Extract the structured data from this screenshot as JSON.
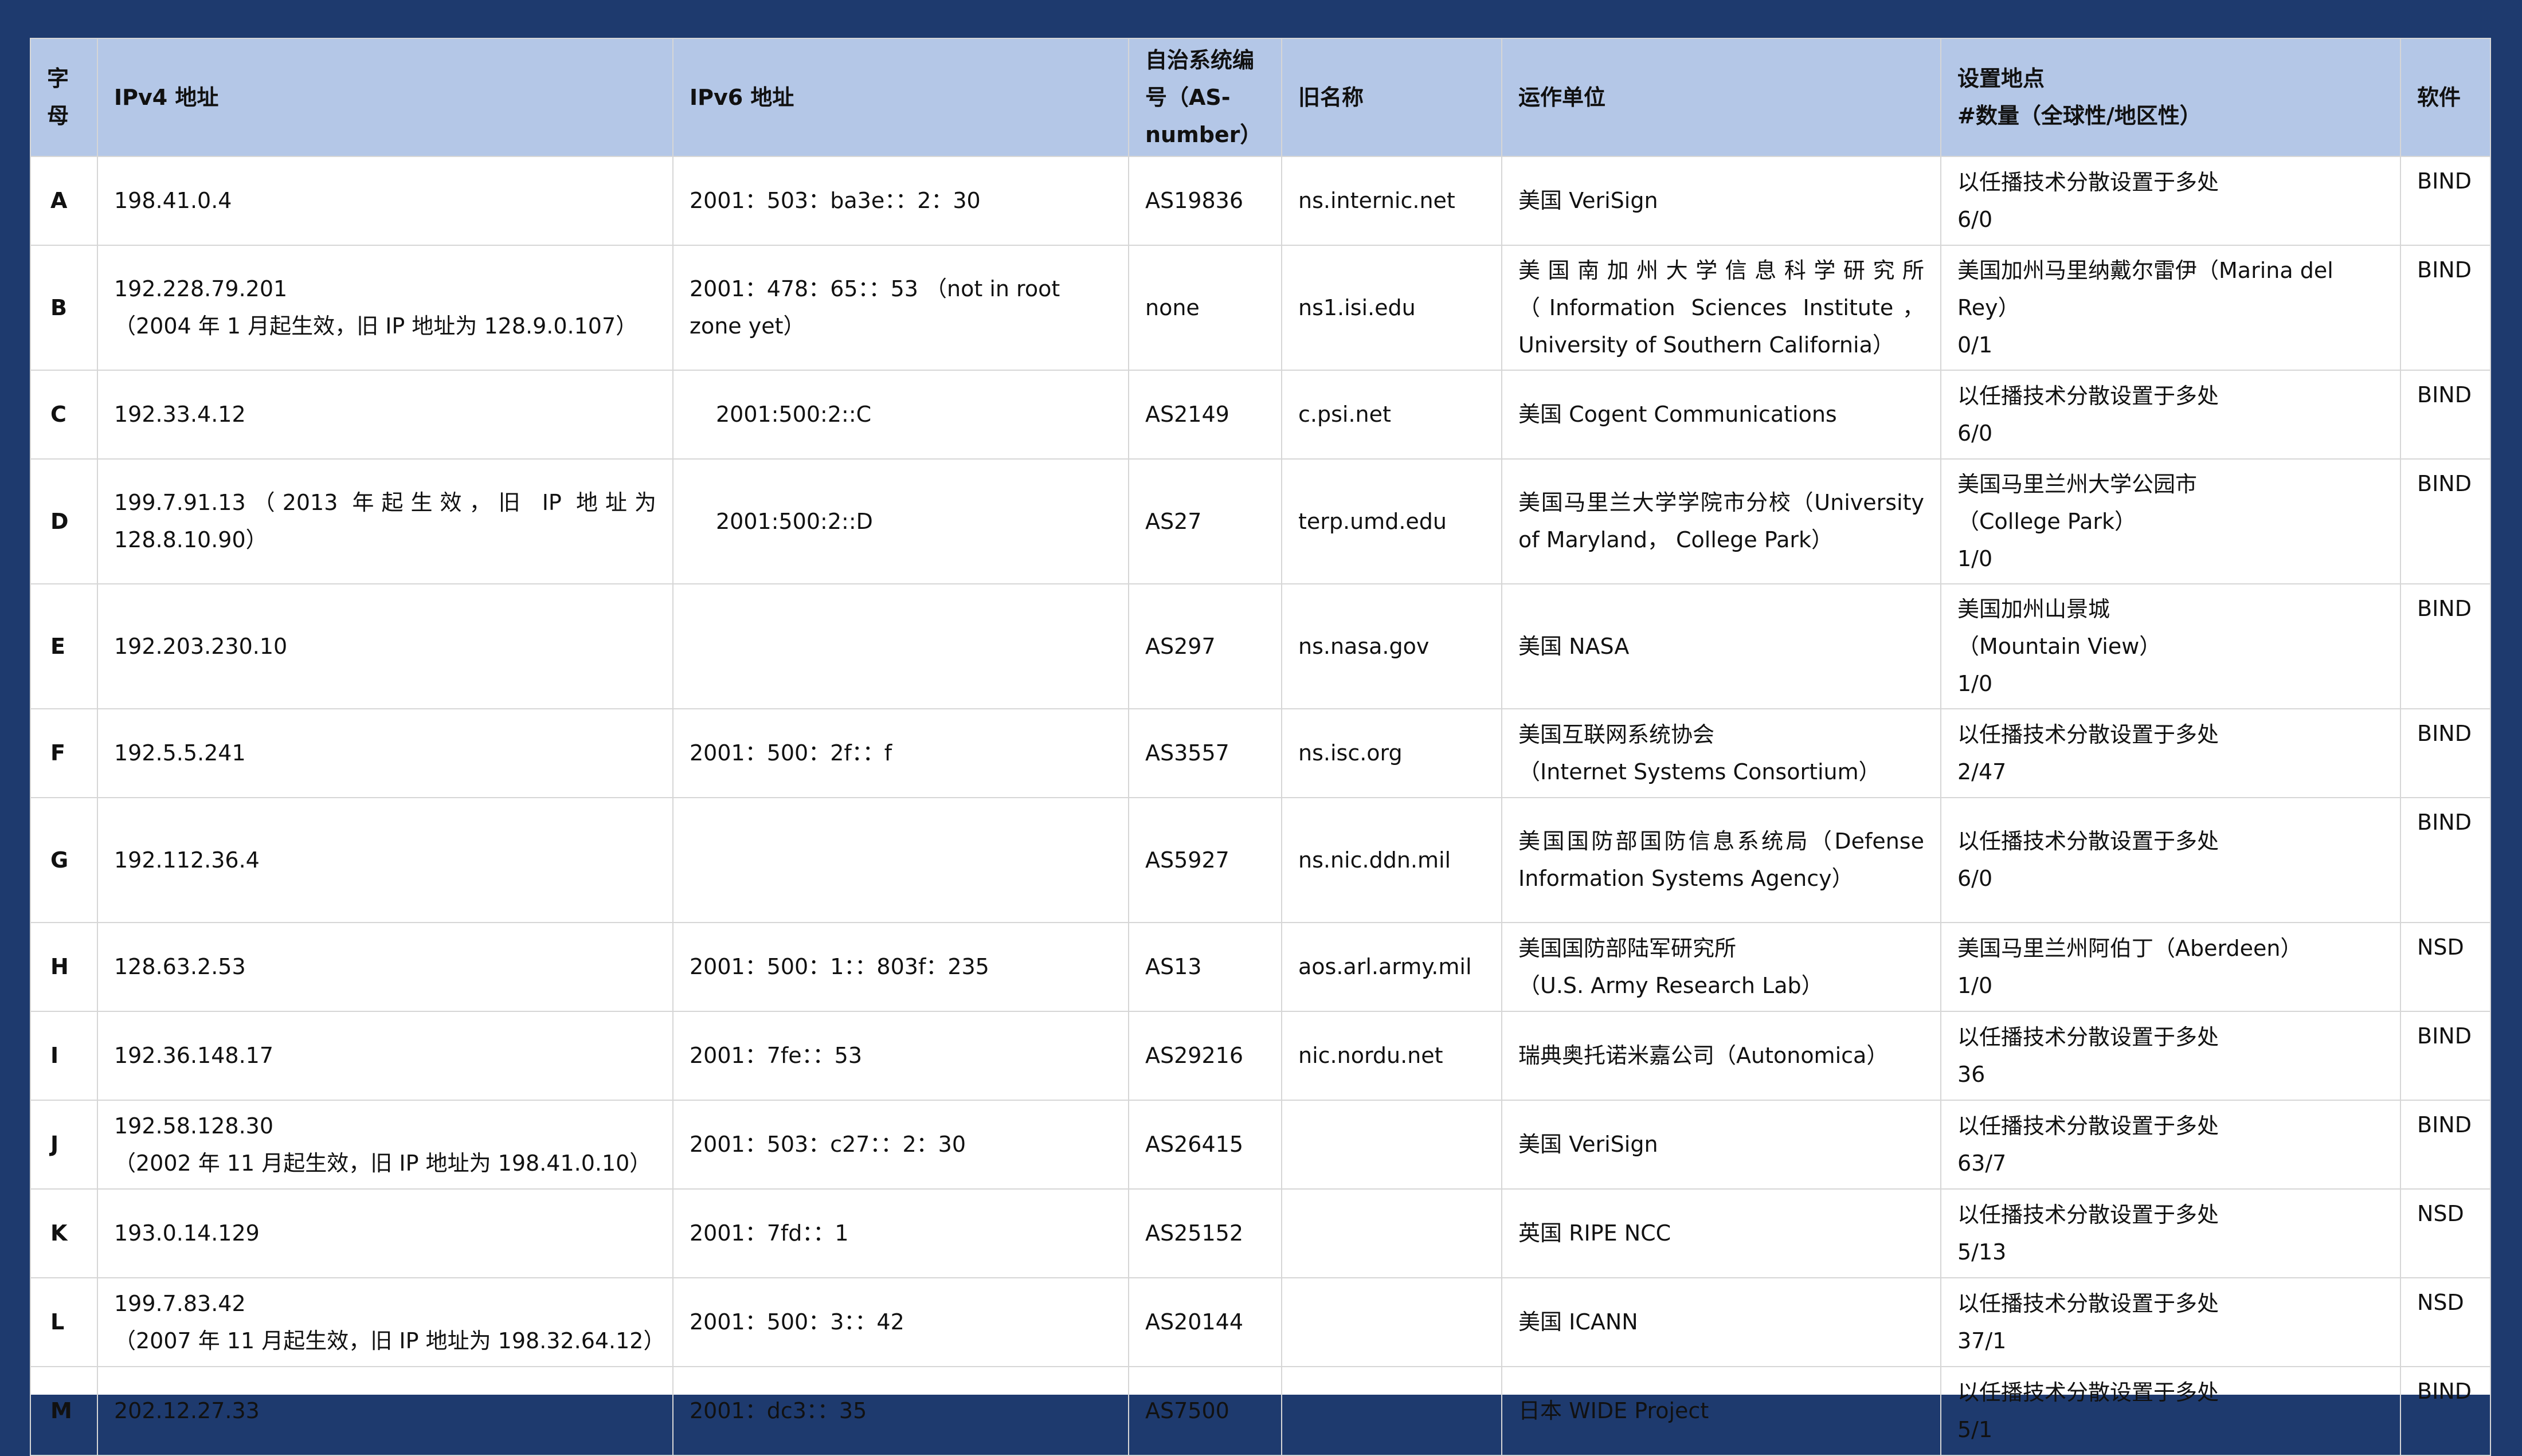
{
  "headers": {
    "letter": "字母",
    "ipv4": "IPv4 地址",
    "ipv6": "IPv6 地址",
    "asn": "自治系统编号（AS-number）",
    "old_name": "旧名称",
    "operator": "运作单位",
    "location_line1": "设置地点",
    "location_line2": "#数量（全球性/地区性）",
    "software": "软件"
  },
  "rows": [
    {
      "letter": "A",
      "ipv4": "198.41.0.4",
      "ipv6": "2001：503：ba3e：：2：30",
      "asn": "AS19836",
      "old_name": "ns.internic.net",
      "operator": "美国 VeriSign",
      "location": "以任播技术分散设置于多处",
      "count": "6/0",
      "software": "BIND"
    },
    {
      "letter": "B",
      "ipv4": "192.228.79.201",
      "ipv4_note": "（2004 年 1 月起生效，旧 IP 地址为 128.9.0.107）",
      "ipv6": "2001：478：65：：53 （not in root zone yet）",
      "asn": "none",
      "old_name": "ns1.isi.edu",
      "operator": "美国南加州大学信息科学研究所（Information Sciences Institute，University of Southern California）",
      "location": "美国加州马里纳戴尔雷伊（Marina del Rey）",
      "count": "0/1",
      "software": "BIND"
    },
    {
      "letter": "C",
      "ipv4": "192.33.4.12",
      "ipv6": "2001:500:2::C",
      "asn": "AS2149",
      "old_name": "c.psi.net",
      "operator": "美国 Cogent Communications",
      "location": "以任播技术分散设置于多处",
      "count": "6/0",
      "software": "BIND"
    },
    {
      "letter": "D",
      "ipv4": "199.7.91.13（2013 年起生效，旧 IP 地址为 128.8.10.90）",
      "ipv6": "2001:500:2::D",
      "asn": "AS27",
      "old_name": "terp.umd.edu",
      "operator": "美国马里兰大学学院市分校（University of Maryland， College Park）",
      "location": "美国马里兰州大学公园市",
      "location_en": "（College Park）",
      "count": "1/0",
      "software": "BIND"
    },
    {
      "letter": "E",
      "ipv4": "192.203.230.10",
      "ipv6": "",
      "asn": "AS297",
      "old_name": "ns.nasa.gov",
      "operator": "美国 NASA",
      "location": "美国加州山景城",
      "location_en": "（Mountain View）",
      "count": "1/0",
      "software": "BIND"
    },
    {
      "letter": "F",
      "ipv4": "192.5.5.241",
      "ipv6": "2001：500：2f：：f",
      "asn": "AS3557",
      "old_name": "ns.isc.org",
      "operator": "美国互联网系统协会",
      "operator_en": "（Internet Systems Consortium）",
      "location": "以任播技术分散设置于多处",
      "count": "2/47",
      "software": "BIND"
    },
    {
      "letter": "G",
      "ipv4": "192.112.36.4",
      "ipv6": "",
      "asn": "AS5927",
      "old_name": "ns.nic.ddn.mil",
      "operator": "美国国防部国防信息系统局（Defense Information Systems Agency）",
      "location": "以任播技术分散设置于多处",
      "count": "6/0",
      "software": "BIND"
    },
    {
      "letter": "H",
      "ipv4": "128.63.2.53",
      "ipv6": "2001：500：1：：803f：235",
      "asn": "AS13",
      "old_name": "aos.arl.army.mil",
      "operator": "美国国防部陆军研究所",
      "operator_en": "（U.S. Army Research Lab）",
      "location": "美国马里兰州阿伯丁（Aberdeen）",
      "count": "1/0",
      "software": "NSD"
    },
    {
      "letter": "I",
      "ipv4": "192.36.148.17",
      "ipv6": "2001：7fe：：53",
      "asn": "AS29216",
      "old_name": "nic.nordu.net",
      "operator": "瑞典奥托诺米嘉公司（Autonomica）",
      "location": "以任播技术分散设置于多处",
      "count": "36",
      "software": "BIND"
    },
    {
      "letter": "J",
      "ipv4": "192.58.128.30",
      "ipv4_note": "（2002 年 11 月起生效，旧 IP 地址为 198.41.0.10）",
      "ipv6": "2001：503：c27：：2：30",
      "asn": "AS26415",
      "old_name": "",
      "operator": "美国 VeriSign",
      "location": "以任播技术分散设置于多处",
      "count": "63/7",
      "software": "BIND"
    },
    {
      "letter": "K",
      "ipv4": "193.0.14.129",
      "ipv6": "2001：7fd：：1",
      "asn": "AS25152",
      "old_name": "",
      "operator": "英国 RIPE NCC",
      "location": "以任播技术分散设置于多处",
      "count": "5/13",
      "software": "NSD"
    },
    {
      "letter": "L",
      "ipv4": "199.7.83.42",
      "ipv4_note": "（2007 年 11 月起生效，旧 IP 地址为 198.32.64.12）",
      "ipv6": "2001：500：3：：42",
      "asn": "AS20144",
      "old_name": "",
      "operator": "美国 ICANN",
      "location": "以任播技术分散设置于多处",
      "count": "37/1",
      "software": "NSD"
    },
    {
      "letter": "M",
      "ipv4": "202.12.27.33",
      "ipv6": "2001：dc3：：35",
      "asn": "AS7500",
      "old_name": "",
      "operator": "日本 WIDE Project",
      "location": "以任播技术分散设置于多处",
      "count": "5/1",
      "software": "BIND"
    }
  ]
}
